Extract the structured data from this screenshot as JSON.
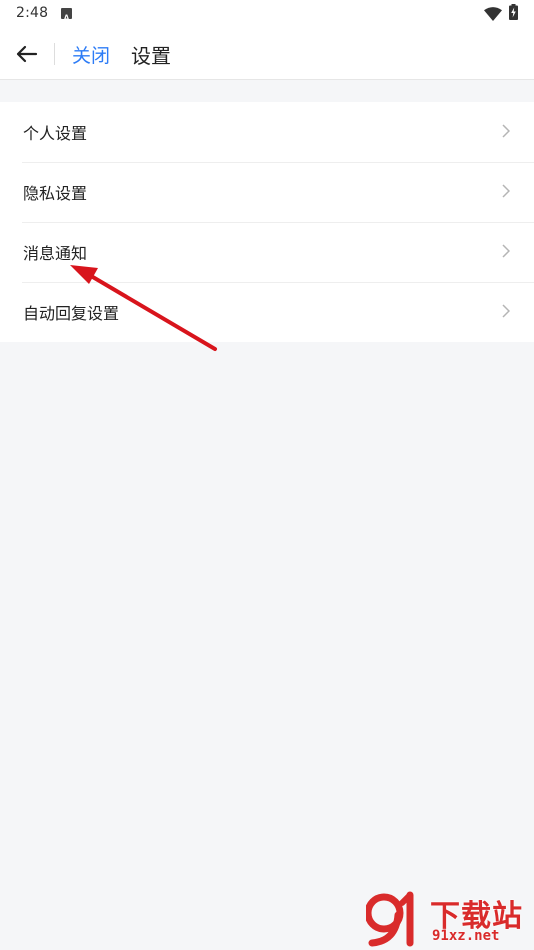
{
  "status_bar": {
    "time": "2:48",
    "notification_icon": "font-app-icon",
    "wifi_icon": "wifi-icon",
    "battery_icon": "battery-charging-icon"
  },
  "header": {
    "back_icon": "arrow-left-icon",
    "close_label": "关闭",
    "title": "设置"
  },
  "settings": {
    "items": [
      {
        "label": "个人设置"
      },
      {
        "label": "隐私设置"
      },
      {
        "label": "消息通知"
      },
      {
        "label": "自动回复设置"
      }
    ],
    "chevron_icon": "chevron-right-icon"
  },
  "annotation": {
    "arrow_color": "#d8141c",
    "arrow_icon": "red-arrow-pointer"
  },
  "watermark": {
    "logo_text": "91",
    "title": "下载站",
    "domain": "91xz.net",
    "color": "#d92b2b"
  },
  "colors": {
    "accent": "#2d7cf6",
    "background": "#f5f6f8"
  }
}
